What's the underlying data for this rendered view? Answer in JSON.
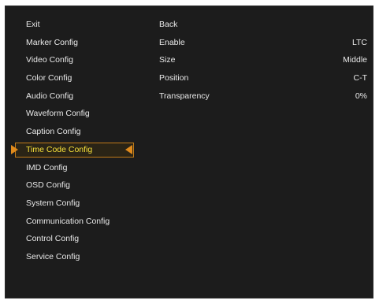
{
  "menu": {
    "items": [
      {
        "label": "Exit"
      },
      {
        "label": "Marker Config"
      },
      {
        "label": "Video Config"
      },
      {
        "label": "Color Config"
      },
      {
        "label": "Audio Config"
      },
      {
        "label": "Waveform Config"
      },
      {
        "label": "Caption Config"
      },
      {
        "label": "Time Code Config"
      },
      {
        "label": "IMD Config"
      },
      {
        "label": "OSD Config"
      },
      {
        "label": "System Config"
      },
      {
        "label": "Communication Config"
      },
      {
        "label": "Control Config"
      },
      {
        "label": "Service Config"
      }
    ],
    "selected": "Time Code Config"
  },
  "submenu": {
    "back_label": "Back",
    "options": [
      {
        "label": "Enable",
        "value": "LTC"
      },
      {
        "label": "Size",
        "value": "Middle"
      },
      {
        "label": "Position",
        "value": "C-T"
      },
      {
        "label": "Transparency",
        "value": "0%"
      },
      {
        "label": "",
        "value": ""
      }
    ]
  },
  "colors": {
    "background": "#1c1c1c",
    "text": "#e8e8e8",
    "selected_text": "#f6e03a",
    "selection_accent": "#e08a1c"
  }
}
